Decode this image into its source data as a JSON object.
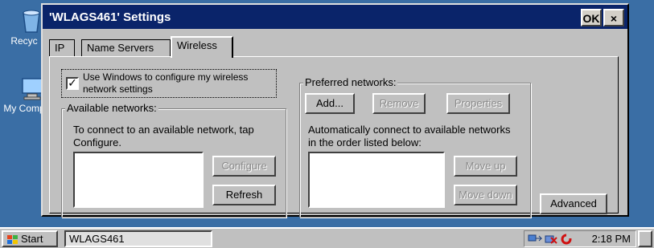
{
  "desktop": {
    "icons": [
      {
        "label": "Recyc",
        "icon": "recycle-bin-icon"
      },
      {
        "label": "My Comp",
        "icon": "my-computer-icon"
      }
    ]
  },
  "dialog": {
    "title": "'WLAGS461' Settings",
    "ok_label": "OK",
    "close_label": "×",
    "tabs": [
      {
        "label": "IP",
        "active": false
      },
      {
        "label": "Name Servers",
        "active": false
      },
      {
        "label": "Wireless",
        "active": true
      }
    ],
    "use_windows": {
      "checked": true,
      "label": "Use Windows to configure my wireless network settings"
    },
    "available": {
      "title": "Available networks:",
      "description": "To connect to an available network, tap Configure.",
      "configure_label": "Configure",
      "refresh_label": "Refresh"
    },
    "preferred": {
      "title": "Preferred networks:",
      "add_label": "Add...",
      "remove_label": "Remove",
      "properties_label": "Properties",
      "description": "Automatically connect to available networks in the order listed below:",
      "move_up_label": "Move up",
      "move_down_label": "Move down"
    },
    "advanced_label": "Advanced"
  },
  "taskbar": {
    "start_label": "Start",
    "task_label": "WLAGS461",
    "clock": "2:18 PM"
  }
}
